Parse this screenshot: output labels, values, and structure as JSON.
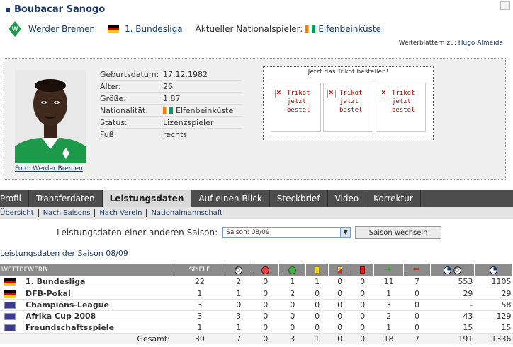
{
  "player": {
    "name": "Boubacar Sanogo",
    "club": "Werder Bremen",
    "league": "1. Bundesliga",
    "national_label": "Aktueller Nationalspieler:",
    "national_team": "Elfenbeinküste",
    "next_label": "Weiterblättern zu:",
    "next_player": "Hugo Almeida",
    "photo_caption": "Foto: Werder Bremen"
  },
  "info": [
    {
      "label": "Geburtsdatum:",
      "value": "17.12.1982"
    },
    {
      "label": "Alter:",
      "value": "26"
    },
    {
      "label": "Größe:",
      "value": "1,87"
    },
    {
      "label": "Nationalität:",
      "value": "Elfenbeinküste"
    },
    {
      "label": "Status:",
      "value": "Lizenzspieler"
    },
    {
      "label": "Fuß:",
      "value": "rechts"
    }
  ],
  "shop": {
    "title": "Jetzt das Trikot bestellen!",
    "items": [
      "Trikot\njetzt\nbestel",
      "Trikot\njetzt\nbestel",
      "Trikot\njetzt\nbestel"
    ]
  },
  "tabs": [
    "Profil",
    "Transferdaten",
    "Leistungsdaten",
    "Auf einen Blick",
    "Steckbrief",
    "Video",
    "Korrektur"
  ],
  "active_tab": "Leistungsdaten",
  "subnav": [
    "Übersicht",
    "Nach Saisons",
    "Nach Verein",
    "Nationalmannschaft"
  ],
  "season": {
    "label": "Leistungsdaten einer anderen Saison:",
    "selected": "Saison: 08/09",
    "button": "Saison wechseln"
  },
  "section_title": "Leistungsdaten der Saison 08/09",
  "table": {
    "headers": {
      "competition": "WETTBEWERB",
      "games": "SPIELE"
    },
    "rows": [
      {
        "competition": "1. Bundesliga",
        "icon": "germany-flag-icon",
        "values": [
          "22",
          "2",
          "0",
          "1",
          "1",
          "0",
          "0",
          "11",
          "7",
          "553",
          "1105"
        ]
      },
      {
        "competition": "DFB-Pokal",
        "icon": "germany-flag-icon",
        "values": [
          "1",
          "1",
          "0",
          "2",
          "0",
          "0",
          "0",
          "1",
          "0",
          "29",
          "29"
        ]
      },
      {
        "competition": "Champions-League",
        "icon": "competition-badge-icon",
        "values": [
          "3",
          "0",
          "0",
          "0",
          "0",
          "0",
          "0",
          "3",
          "0",
          "-",
          "58"
        ]
      },
      {
        "competition": "Afrika Cup 2008",
        "icon": "competition-badge-icon",
        "values": [
          "3",
          "3",
          "0",
          "0",
          "0",
          "0",
          "0",
          "2",
          "0",
          "43",
          "129"
        ]
      },
      {
        "competition": "Freundschaftsspiele",
        "icon": "competition-badge-icon",
        "values": [
          "1",
          "1",
          "0",
          "0",
          "0",
          "0",
          "0",
          "1",
          "0",
          "15",
          "15"
        ]
      }
    ],
    "total": {
      "label": "Gesamt:",
      "values": [
        "30",
        "7",
        "0",
        "3",
        "1",
        "0",
        "0",
        "18",
        "7",
        "191",
        "1336"
      ]
    }
  }
}
